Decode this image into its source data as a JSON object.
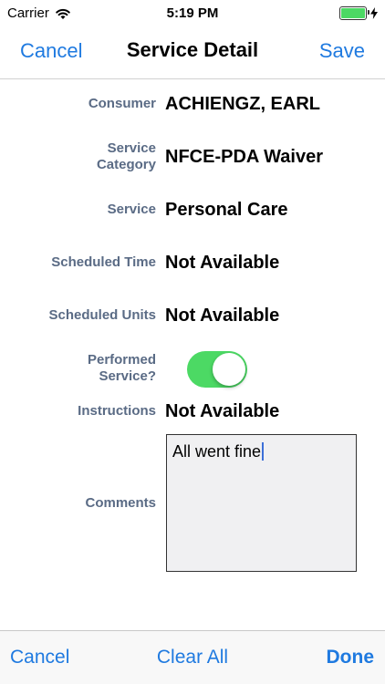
{
  "status_bar": {
    "carrier": "Carrier",
    "time": "5:19 PM",
    "battery_level": 1.0,
    "charging": true,
    "wifi_icon": "wifi-icon"
  },
  "nav": {
    "cancel_label": "Cancel",
    "title": "Service Detail",
    "save_label": "Save"
  },
  "form": {
    "consumer": {
      "label": "Consumer",
      "value": "ACHIENGZ, EARL"
    },
    "service_category": {
      "label_line1": "Service",
      "label_line2": "Category",
      "value": "NFCE-PDA Waiver"
    },
    "service": {
      "label": "Service",
      "value": "Personal Care"
    },
    "scheduled_time": {
      "label": "Scheduled Time",
      "value": "Not Available"
    },
    "scheduled_units": {
      "label": "Scheduled Units",
      "value": "Not Available"
    },
    "performed_service": {
      "label_line1": "Performed",
      "label_line2": "Service?",
      "checked": true
    },
    "instructions": {
      "label": "Instructions",
      "value": "Not Available"
    },
    "comments": {
      "label": "Comments",
      "value": "All went fine"
    }
  },
  "toolbar": {
    "cancel_label": "Cancel",
    "clear_all_label": "Clear All",
    "done_label": "Done"
  },
  "colors": {
    "accent": "#1f7ae0",
    "label": "#5a6b85",
    "toggle_on": "#4cd964",
    "battery": "#4cd964"
  }
}
